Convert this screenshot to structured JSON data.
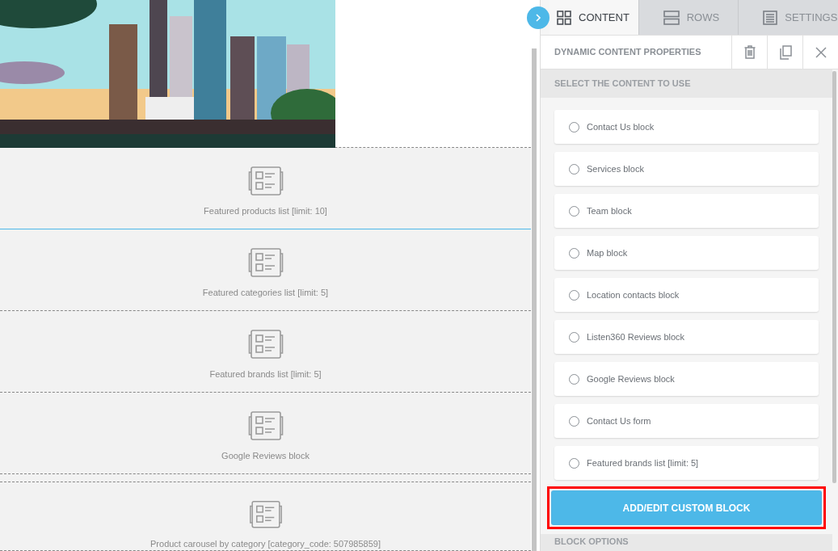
{
  "canvas": {
    "blocks": [
      {
        "label": "Featured products list [limit: 10]",
        "selected": true
      },
      {
        "label": "Featured categories list [limit: 5]",
        "selected": false
      },
      {
        "label": "Featured brands list [limit: 5]",
        "selected": false
      },
      {
        "label": "Google Reviews block",
        "selected": false
      },
      {
        "label": "Product carousel by category [category_code: 507985859]",
        "selected": false
      }
    ]
  },
  "panel": {
    "tabs": [
      {
        "label": "CONTENT",
        "kind": "grid",
        "selected": true
      },
      {
        "label": "ROWS",
        "kind": "rows",
        "selected": false
      },
      {
        "label": "SETTINGS",
        "kind": "doc",
        "selected": false
      }
    ],
    "title": "DYNAMIC CONTENT PROPERTIES",
    "section": "SELECT THE CONTENT TO USE",
    "options": [
      {
        "label": "Contact Us block",
        "selected": false
      },
      {
        "label": "Services block",
        "selected": false
      },
      {
        "label": "Team block",
        "selected": false
      },
      {
        "label": "Map block",
        "selected": false
      },
      {
        "label": "Location contacts block",
        "selected": false
      },
      {
        "label": "Listen360 Reviews block",
        "selected": false
      },
      {
        "label": "Google Reviews block",
        "selected": false
      },
      {
        "label": "Contact Us form",
        "selected": false
      },
      {
        "label": "Featured brands list [limit: 5]",
        "selected": false
      }
    ],
    "button": "ADD/EDIT CUSTOM BLOCK",
    "next_section": "BLOCK OPTIONS"
  }
}
